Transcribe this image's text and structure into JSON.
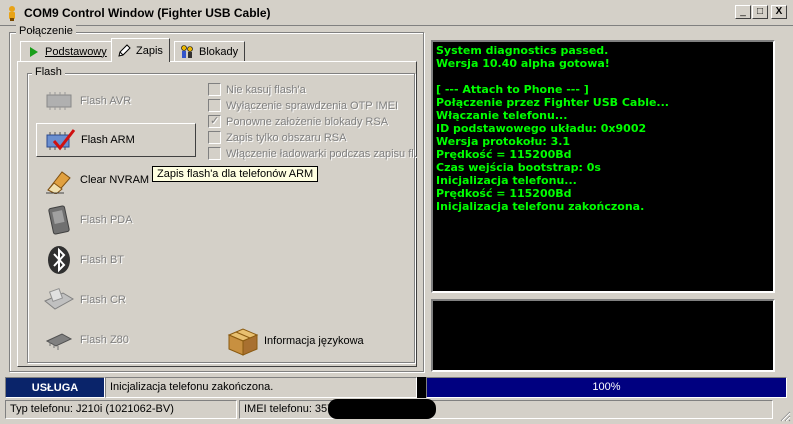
{
  "window": {
    "title": "COM9 Control Window (Fighter USB Cable)",
    "controls": {
      "minimize": "_",
      "maximize": "□",
      "close": "X"
    }
  },
  "group": {
    "title": "Połączenie"
  },
  "tabs": [
    {
      "label": "Podstawowy",
      "icon": "play-icon",
      "active": false
    },
    {
      "label": "Zapis",
      "icon": "pen-icon",
      "active": true
    },
    {
      "label": "Blokady",
      "icon": "lock-people-icon",
      "active": false
    }
  ],
  "flash": {
    "title": "Flash",
    "buttons": [
      {
        "label": "Flash AVR",
        "icon": "chip-icon",
        "enabled": false
      },
      {
        "label": "Flash ARM",
        "icon": "chip-check-icon",
        "enabled": true
      },
      {
        "label": "Clear NVRAM",
        "icon": "eraser-icon",
        "enabled": true
      },
      {
        "label": "Flash PDA",
        "icon": "pda-icon",
        "enabled": false
      },
      {
        "label": "Flash BT",
        "icon": "bluetooth-icon",
        "enabled": false
      },
      {
        "label": "Flash CR",
        "icon": "card-reader-icon",
        "enabled": false
      },
      {
        "label": "Flash Z80",
        "icon": "chip-z80-icon",
        "enabled": false
      }
    ],
    "options": [
      {
        "label": "Nie kasuj flash'a",
        "checked": false
      },
      {
        "label": "Wyłączenie sprawdzenia OTP IMEI",
        "checked": false
      },
      {
        "label": "Ponowne założenie blokady RSA",
        "checked": true
      },
      {
        "label": "Zapis tylko obszaru RSA",
        "checked": false
      },
      {
        "label": "Włączenie ładowarki podczas zapisu fl.",
        "checked": false
      }
    ],
    "tooltip": "Zapis flash'a dla telefonów ARM",
    "lang_button": "Informacja językowa"
  },
  "console": {
    "lines": [
      "System diagnostics passed.",
      "Wersja 10.40 alpha gotowa!",
      "",
      "[ --- Attach to Phone --- ]",
      "Połączenie przez Fighter USB Cable...",
      "Włączanie telefonu...",
      "ID podstawowego układu: 0x9002",
      "Wersja protokołu: 3.1",
      "Prędkość = 115200Bd",
      "Czas wejścia bootstrap: 0s",
      "Inicjalizacja telefonu...",
      "Prędkość = 115200Bd",
      "Inicjalizacja telefonu zakończona."
    ]
  },
  "status": {
    "mode": "USŁUGA",
    "message": "Inicjalizacja telefonu zakończona.",
    "progress_text": "100%",
    "progress_value": 100,
    "phone_type": "Typ telefonu: J210i (1021062-BV)",
    "imei": "IMEI telefonu: 357"
  },
  "colors": {
    "console_bg": "#000000",
    "console_text": "#00ff00",
    "status_accent": "#0a246a",
    "progress_fill": "#000080"
  }
}
